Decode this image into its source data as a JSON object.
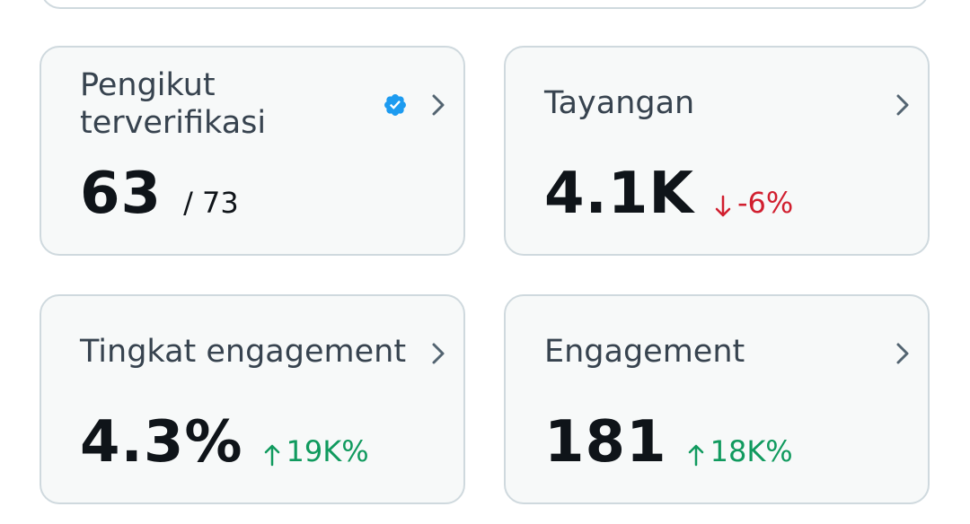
{
  "cards": [
    {
      "title_lines": [
        "Pengikut",
        "terverifikasi"
      ],
      "value": "63",
      "total": "/ 73",
      "verified_icon": "verified-badge-icon"
    },
    {
      "title": "Tayangan",
      "value": "4.1K",
      "change": "-6%",
      "change_direction": "down"
    },
    {
      "title": "Tingkat engagement",
      "value": "4.3%",
      "change": "19K%",
      "change_direction": "up"
    },
    {
      "title": "Engagement",
      "value": "181",
      "change": "18K%",
      "change_direction": "up"
    }
  ],
  "colors": {
    "card_background": "#f7f9f9",
    "card_border": "#cfd9de",
    "title": "#37434f",
    "value": "#0f1419",
    "change_down": "#d11f2f",
    "change_up": "#109a5e",
    "verified": "#1d9bf0",
    "chevron": "#536471"
  }
}
